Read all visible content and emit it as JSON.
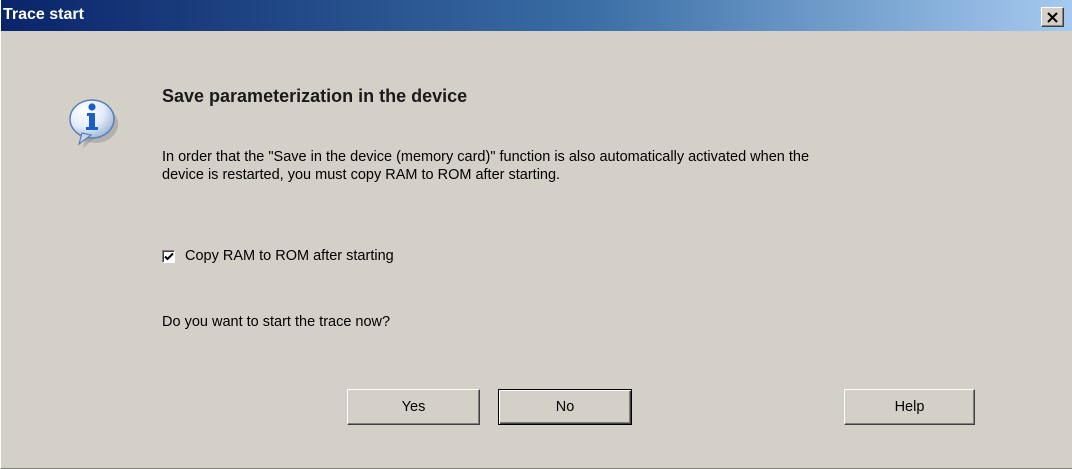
{
  "window": {
    "title": "Trace start",
    "close_icon": "close-icon"
  },
  "dialog": {
    "icon": "info-icon",
    "heading": "Save parameterization in the device",
    "message_line1": "In order that the \"Save in the device (memory card)\" function is also automatically activated when the",
    "message_line2": "device is restarted, you must copy RAM to ROM after starting.",
    "checkbox_label": "Copy RAM to ROM after starting",
    "checkbox_checked": true,
    "question": "Do you want to start the trace now?"
  },
  "buttons": {
    "yes": "Yes",
    "no": "No",
    "help": "Help"
  },
  "colors": {
    "dialog_background": "#d4d0c8",
    "titlebar_start": "#0a246a",
    "titlebar_end": "#a6caf0",
    "info_icon_blue": "#1a5fc8"
  }
}
